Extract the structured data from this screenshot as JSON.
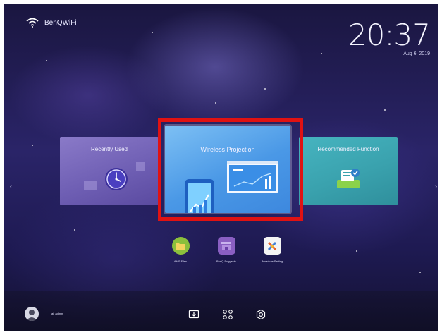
{
  "status": {
    "wifi_name": "BenQWiFi",
    "time": "20:37",
    "date": "Aug 6, 2019"
  },
  "cards": {
    "recent": {
      "title": "Recently Used"
    },
    "wireless": {
      "title": "Wireless Projection"
    },
    "recommend": {
      "title": "Recommended Function"
    }
  },
  "apps": [
    {
      "label": "AMS Files",
      "icon": "folder-icon",
      "color": "#8bbf3c"
    },
    {
      "label": "BenQ Suggests",
      "icon": "store-icon",
      "color": "#8a5fc2"
    },
    {
      "label": "BroadcastSetting",
      "icon": "broadcast-icon",
      "color": "#f4f4f4"
    }
  ],
  "user": {
    "name": "ai_admin"
  },
  "colors": {
    "highlight": "#e01212",
    "wireless_card": "#4a98e6",
    "recent_card": "#6f5fb4",
    "recommend_card": "#3aa2ae"
  }
}
